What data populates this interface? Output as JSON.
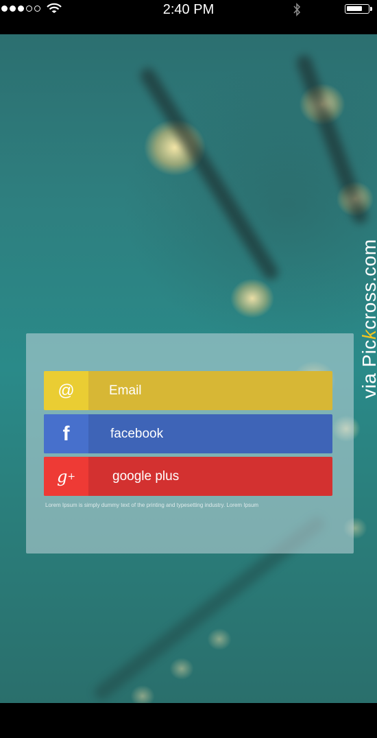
{
  "status_bar": {
    "time": "2:40 PM",
    "signal_dots_filled": 3,
    "signal_dots_total": 5
  },
  "watermark": {
    "prefix": "via Pic",
    "highlight": "k",
    "suffix": "cross.com",
    "highlight_color": "#f2c520"
  },
  "login_panel": {
    "buttons": [
      {
        "label": "Email",
        "icon": "@",
        "icon_name": "at-icon",
        "color": "#d7b735",
        "icon_bg": "#eacd33"
      },
      {
        "label": "facebook",
        "icon": "f",
        "icon_name": "facebook-icon",
        "color": "#3e64b7",
        "icon_bg": "#4770cc"
      },
      {
        "label": "google plus",
        "icon": "g",
        "icon_name": "google-plus-icon",
        "color": "#d33130",
        "icon_bg": "#ee3a35"
      }
    ],
    "disclaimer": "Lorem Ipsum is simply dummy text of the printing and typesetting industry. Lorem Ipsum"
  }
}
